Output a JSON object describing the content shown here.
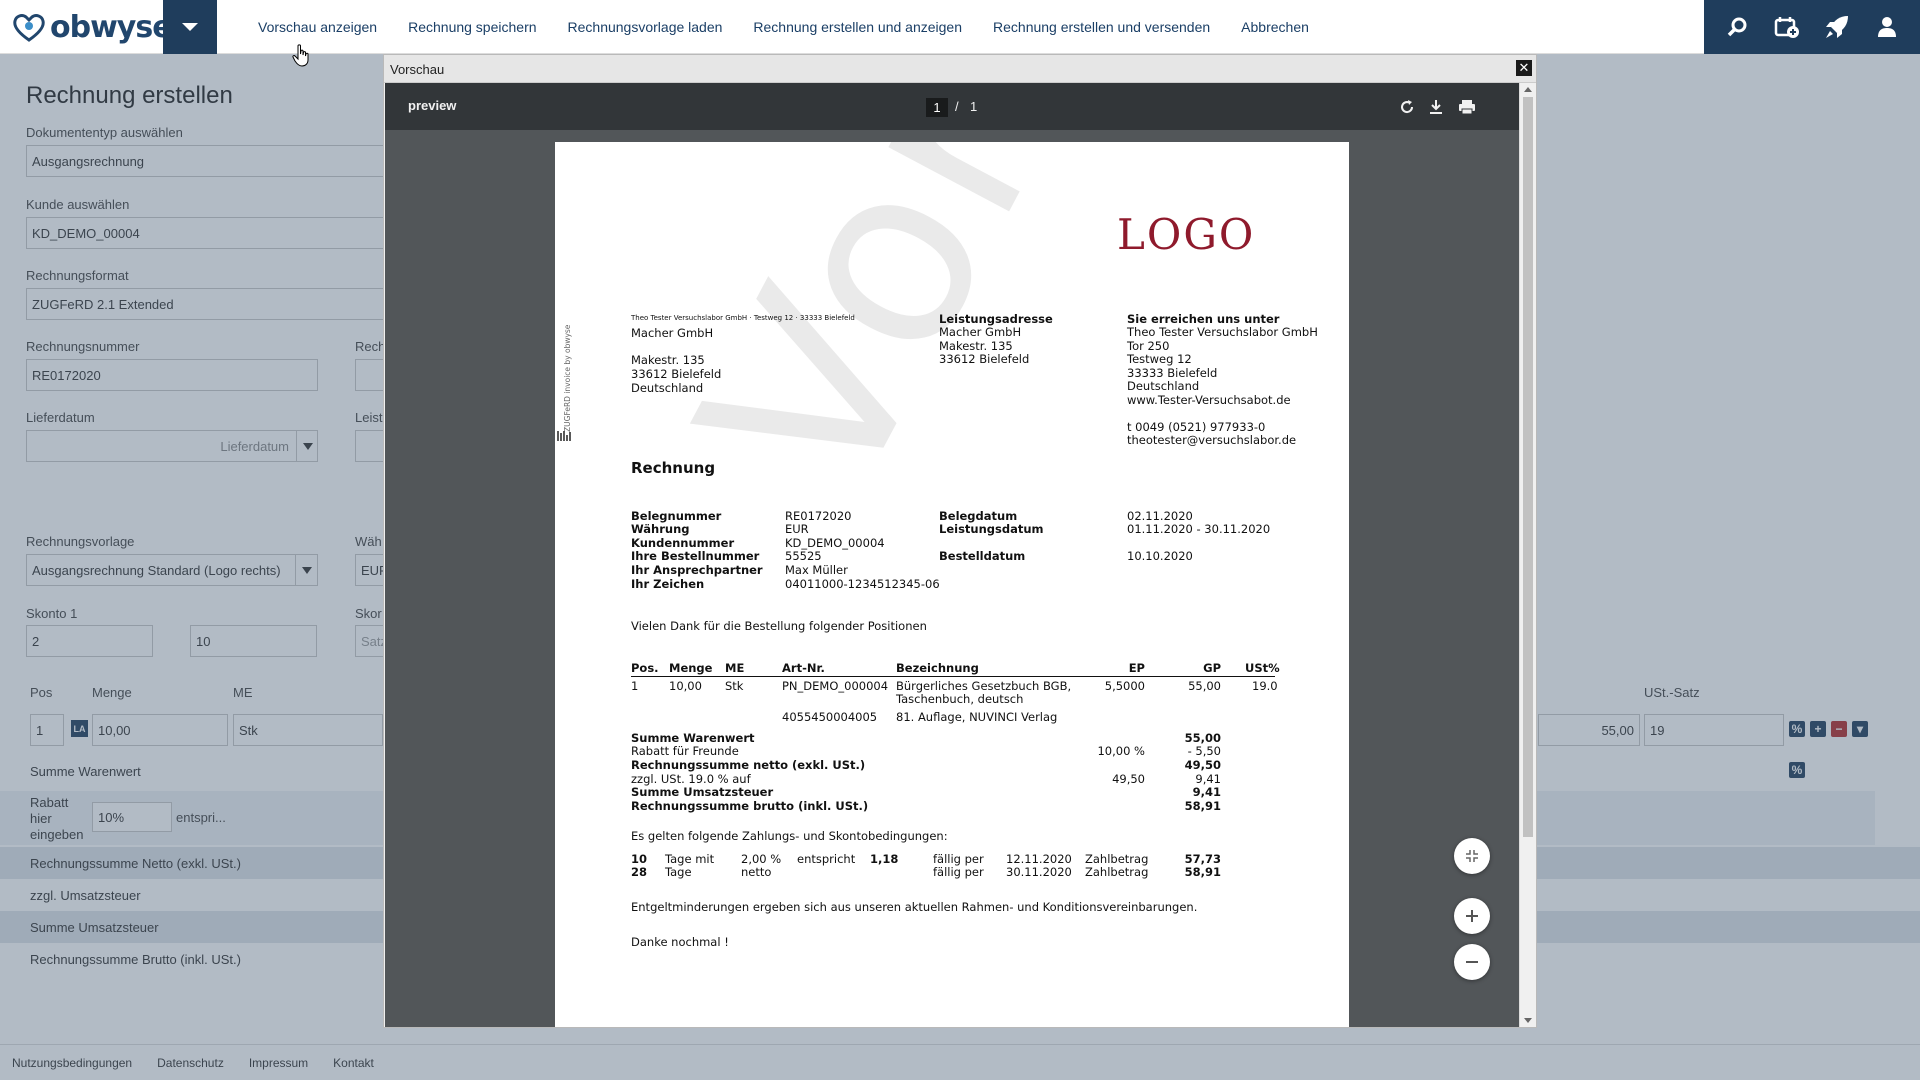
{
  "app": {
    "logo_text": "obwyse",
    "brand_color": "#21466d"
  },
  "menu": [
    "Vorschau anzeigen",
    "Rechnung speichern",
    "Rechnungsvorlage laden",
    "Rechnung erstellen und anzeigen",
    "Rechnung erstellen und versenden",
    "Abbrechen"
  ],
  "topicons": [
    "search-icon",
    "add-calendar-icon",
    "rocket-icon",
    "user-icon"
  ],
  "form": {
    "title": "Rechnung erstellen",
    "doctype_label": "Dokumententyp auswählen",
    "doctype_value": "Ausgangsrechnung",
    "customer_label": "Kunde auswählen",
    "customer_value": "KD_DEMO_00004",
    "format_label": "Rechnungsformat",
    "format_value": "ZUGFeRD 2.1 Extended",
    "number_label": "Rechnungsnummer",
    "number_value": "RE0172020",
    "rech_partial": "Rech",
    "delivery_label": "Lieferdatum",
    "delivery_placeholder": "Lieferdatum",
    "leist_partial": "Leist",
    "template_label": "Rechnungsvorlage",
    "template_value": "Ausgangsrechnung Standard (Logo rechts)",
    "waeh_partial": "Wäh",
    "eur_partial": "EUR",
    "skonto_label": "Skonto 1",
    "skonto_a": "2",
    "skonto_b": "10",
    "skor_partial": "Skor",
    "satz_partial": "Satz",
    "pos_header": "Pos",
    "menge_header": "Menge",
    "me_header": "ME",
    "ust_header": "USt.-Satz",
    "pos_value": "1",
    "la_badge": "LA",
    "menge_value": "10,00",
    "me_value": "Stk",
    "gp_value": "55,00",
    "ust_value": "19",
    "summe_warenwert": "Summe Warenwert",
    "rabatt_label": "Rabatt hier eingeben",
    "rabatt_value": "10%",
    "rabatt_suffix": "entspri...",
    "netto": "Rechnungssumme Netto (exkl. USt.)",
    "zzgl": "zzgl. Umsatzsteuer",
    "summe_ust": "Summe Umsatzsteuer",
    "brutto": "Rechnungssumme Brutto (inkl. USt.)"
  },
  "footer": [
    "Nutzungsbedingungen",
    "Datenschutz",
    "Impressum",
    "Kontakt"
  ],
  "modal": {
    "title": "Vorschau",
    "viewer_name": "preview",
    "page_current": "1",
    "page_sep": "/",
    "page_total": "1"
  },
  "invoice": {
    "logo": "LOGO",
    "watermark": "Vorschau",
    "sender_line": "Theo Tester Versuchslabor GmbH · Testweg 12 · 33333 Bielefeld",
    "side_text": "ZUGFeRD invoice by obwyse",
    "recipient": [
      "Macher GmbH",
      "",
      "Makestr. 135",
      "33612 Bielefeld",
      "Deutschland"
    ],
    "service_addr_title": "Leistungsadresse",
    "service_addr": [
      "Macher GmbH",
      "Makestr. 135",
      "33612 Bielefeld"
    ],
    "contact_title": "Sie erreichen uns unter",
    "contact": [
      "Theo Tester Versuchslabor GmbH",
      "Tor 250",
      "Testweg 12",
      "33333 Bielefeld",
      "Deutschland",
      "www.Tester-Versuchsabot.de",
      "",
      "t  0049  (0521)  977933-0",
      "theotester@versuchslabor.de"
    ],
    "heading": "Rechnung",
    "meta_left_labels": [
      "Belegnummer",
      "Währung",
      "Kundennummer",
      "Ihre Bestellnummer",
      "Ihr Ansprechpartner",
      "Ihr Zeichen"
    ],
    "meta_left_values": [
      "RE0172020",
      "EUR",
      "KD_DEMO_00004",
      "55525",
      "Max Müller",
      "04011000-1234512345-06"
    ],
    "meta_right_labels": [
      "Belegdatum",
      "Leistungsdatum",
      "",
      "Bestelldatum"
    ],
    "meta_right_values": [
      "02.11.2020",
      "01.11.2020 - 30.11.2020",
      "",
      "10.10.2020"
    ],
    "intro": "Vielen Dank für die Bestellung folgender Positionen",
    "table_headers": [
      "Pos.",
      "Menge",
      "ME",
      "Art-Nr.",
      "Bezeichnung",
      "EP",
      "GP",
      "USt%"
    ],
    "item": {
      "pos": "1",
      "menge": "10,00",
      "me": "Stk",
      "art": "PN_DEMO_000004",
      "bez1": "Bürgerliches Gesetzbuch BGB,",
      "bez2": "Taschenbuch, deutsch",
      "ep": "5,5000",
      "gp": "55,00",
      "ust": "19.0",
      "art2": "4055450004005",
      "bez3": "81. Auflage, NUVINCI Verlag"
    },
    "sum_labels": [
      "Summe Warenwert",
      "Rabatt für Freunde",
      "Rechnungssumme netto (exkl. USt.)",
      "zzgl. USt. 19.0 % auf",
      "Summe Umsatzsteuer",
      "Rechnungssumme brutto (inkl. USt.)"
    ],
    "sum_mid": [
      "",
      "10,00 %",
      "",
      "49,50",
      "",
      ""
    ],
    "sum_values": [
      "55,00",
      "- 5,50",
      "49,50",
      "9,41",
      "9,41",
      "58,91"
    ],
    "terms_intro": "Es gelten folgende Zahlungs- und Skontobedingungen:",
    "term1": [
      "10",
      "Tage mit",
      "2,00 %",
      "entspricht",
      "1,18",
      "fällig per",
      "12.11.2020",
      "Zahlbetrag",
      "57,73"
    ],
    "term2": [
      "28",
      "Tage",
      "netto",
      "",
      "",
      "fällig per",
      "30.11.2020",
      "Zahlbetrag",
      "58,91"
    ],
    "note": "Entgeltminderungen ergeben sich aus unseren aktuellen Rahmen- und Konditionsvereinbarungen.",
    "thanks": "Danke nochmal !"
  }
}
